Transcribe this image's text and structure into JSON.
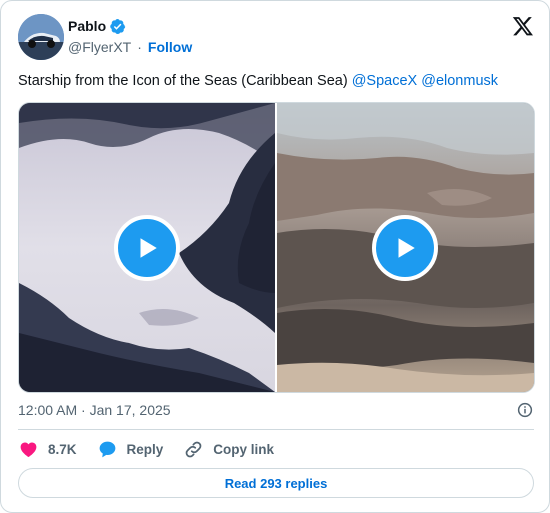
{
  "author": {
    "name": "Pablo",
    "handle": "@FlyerXT",
    "separator": "·",
    "follow_label": "Follow"
  },
  "tweet": {
    "text": "Starship from the Icon of the Seas (Caribbean Sea) ",
    "mentions": [
      "@SpaceX",
      "@elonmusk"
    ],
    "timestamp": "12:00 AM · Jan 17, 2025"
  },
  "media": {
    "videos": [
      {
        "icon": "play-icon"
      },
      {
        "icon": "play-icon"
      }
    ]
  },
  "actions": {
    "like_count": "8.7K",
    "reply_label": "Reply",
    "copy_link_label": "Copy link"
  },
  "footer": {
    "read_replies_label": "Read 293 replies"
  },
  "colors": {
    "accent": "#1d9bf0",
    "link": "#006fd6",
    "like": "#f91880",
    "muted": "#536471",
    "border": "#cfd9de"
  }
}
